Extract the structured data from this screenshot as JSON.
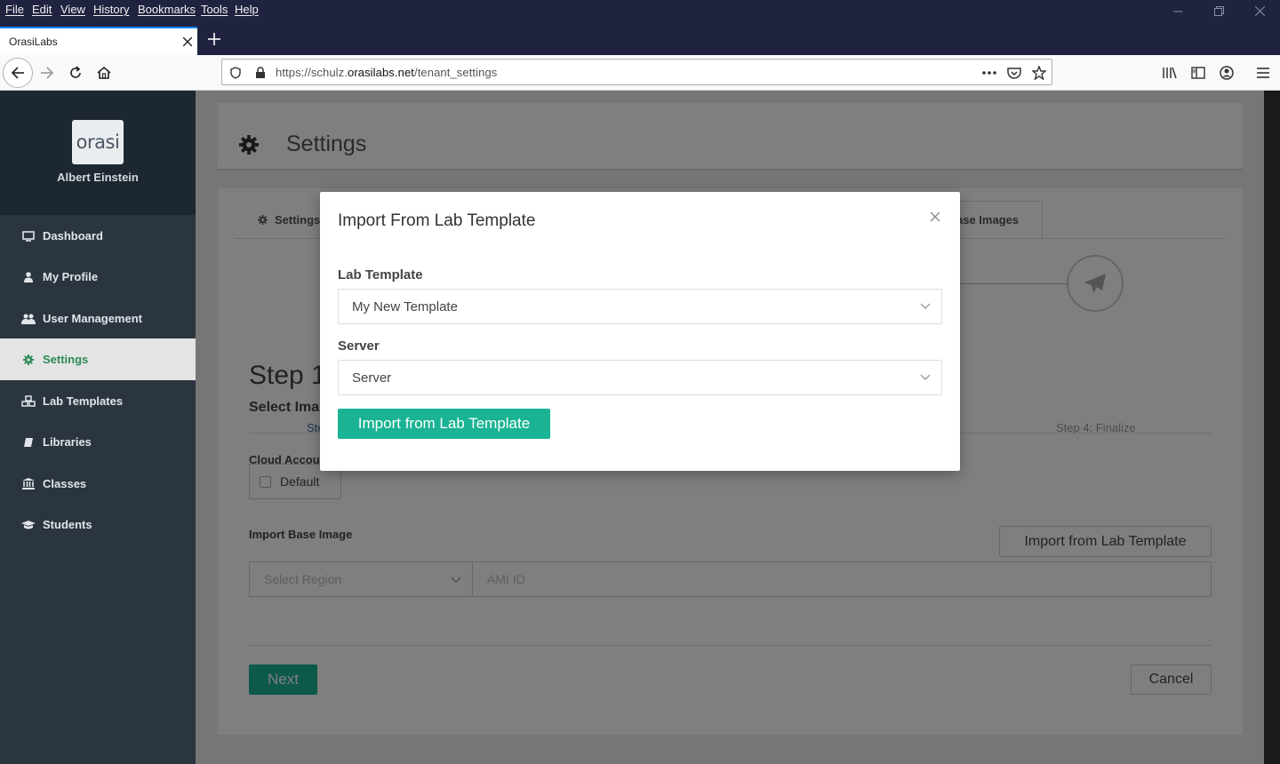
{
  "browser": {
    "menu": [
      "File",
      "Edit",
      "View",
      "History",
      "Bookmarks",
      "Tools",
      "Help"
    ],
    "tab_title": "OrasiLabs",
    "url_prefix": "https://schulz.",
    "url_domain": "orasilabs.net",
    "url_suffix": "/tenant_settings"
  },
  "sidebar": {
    "logo_text": "orasi",
    "user_name": "Albert Einstein",
    "items": [
      {
        "label": "Dashboard",
        "icon": "monitor-icon"
      },
      {
        "label": "My Profile",
        "icon": "user-icon"
      },
      {
        "label": "User Management",
        "icon": "users-icon"
      },
      {
        "label": "Settings",
        "icon": "gear-icon"
      },
      {
        "label": "Lab Templates",
        "icon": "cubes-icon"
      },
      {
        "label": "Libraries",
        "icon": "book-icon"
      },
      {
        "label": "Classes",
        "icon": "institution-icon"
      },
      {
        "label": "Students",
        "icon": "graduation-cap-icon"
      }
    ],
    "active_index": 3
  },
  "page": {
    "title": "Settings",
    "wizard_tabs": {
      "first": "Settings",
      "last": "ase Images"
    },
    "step_left_label": "Ste",
    "step4_label": "Step 4: Finalize",
    "step_title": "Step 1",
    "step_subtitle": "Select Ima",
    "cloud_account_label": "Cloud Accou",
    "default_label": "Default",
    "import_base_image_label": "Import Base Image",
    "import_button": "Import from Lab Template",
    "region_placeholder": "Select Region",
    "ami_placeholder": "AMI ID",
    "next_button": "Next",
    "cancel_button": "Cancel"
  },
  "modal": {
    "title": "Import From Lab Template",
    "lab_template_label": "Lab Template",
    "lab_template_value": "My New Template",
    "server_label": "Server",
    "server_value": "Server",
    "submit_button": "Import from Lab Template"
  },
  "colors": {
    "accent_green": "#1ab394",
    "sidebar_bg": "#2b3540",
    "titlebar_bg": "#202340"
  }
}
